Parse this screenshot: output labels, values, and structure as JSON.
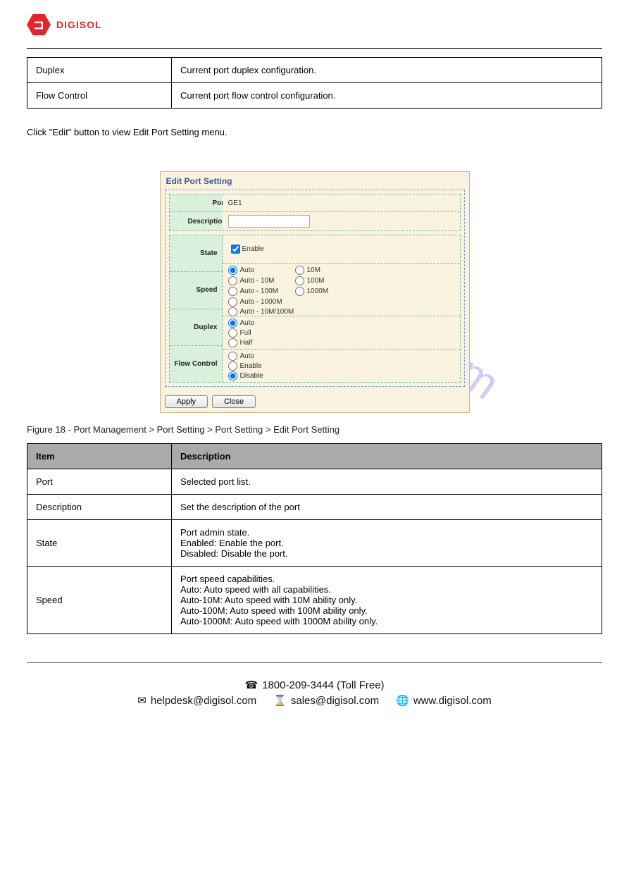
{
  "brand": "DIGISOL",
  "top_table": {
    "rows": [
      [
        "Duplex",
        "Current port duplex configuration."
      ],
      [
        "Flow Control",
        "Current port flow control configuration."
      ]
    ]
  },
  "intro_text": "Click \"Edit\" button to view Edit Port Setting menu.",
  "panel": {
    "title": "Edit Port Setting",
    "port_label": "Port",
    "port_value": "GE1",
    "description_label": "Description",
    "description_value": "",
    "state_label": "State",
    "state_checkbox": "Enable",
    "speed_label": "Speed",
    "speed_options_left": [
      "Auto",
      "Auto - 10M",
      "Auto - 100M",
      "Auto - 1000M",
      "Auto - 10M/100M"
    ],
    "speed_options_right": [
      "10M",
      "100M",
      "1000M"
    ],
    "speed_value": "Auto",
    "duplex_label": "Duplex",
    "duplex_options": [
      "Auto",
      "Full",
      "Half"
    ],
    "duplex_value": "Auto",
    "flow_label": "Flow Control",
    "flow_options": [
      "Auto",
      "Enable",
      "Disable"
    ],
    "flow_value": "Disable",
    "apply_btn": "Apply",
    "close_btn": "Close"
  },
  "figure_caption": "Figure 18 - Port Management > Port Setting > Port Setting > Edit Port Setting",
  "bottom_table": {
    "headers": [
      "Item",
      "Description"
    ],
    "rows": [
      [
        "Port",
        "Selected port list."
      ],
      [
        "Description",
        "Set the description of the port"
      ],
      [
        "State",
        "Port admin state.\nEnabled: Enable the port.\nDisabled: Disable the port."
      ],
      [
        "Speed",
        "Port speed capabilities.\nAuto: Auto speed with all capabilities.\nAuto-10M: Auto speed with 10M ability only.\nAuto-100M: Auto speed with 100M ability only.\nAuto-1000M: Auto speed with 1000M ability only."
      ]
    ]
  },
  "watermark": "manualshive.com",
  "footer": {
    "phone": "1800-209-3444 (Toll Free)",
    "helpdesk": "helpdesk@digisol.com",
    "sales": "sales@digisol.com",
    "web": "www.digisol.com"
  },
  "icons": {
    "phone": "☎",
    "mail": "✉",
    "hourglass": "⌛",
    "globe": "🌐"
  }
}
